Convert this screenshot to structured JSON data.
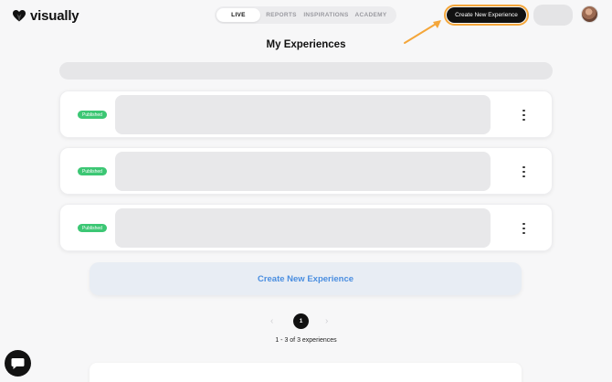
{
  "header": {
    "brand": "visually",
    "tabs": [
      {
        "label": "LIVE",
        "active": true
      },
      {
        "label": "REPORTS",
        "active": false
      },
      {
        "label": "INSPIRATIONS",
        "active": false
      },
      {
        "label": "ACADEMY",
        "active": false
      }
    ],
    "create_button_label": "Create New Experience",
    "highlight_color": "#f4a63a"
  },
  "main": {
    "title": "My Experiences",
    "experiences": [
      {
        "status": "Published"
      },
      {
        "status": "Published"
      },
      {
        "status": "Published"
      }
    ],
    "create_banner_label": "Create New Experience",
    "pagination": {
      "prev": "‹",
      "current_page": "1",
      "next": "›",
      "summary": "1 - 3 of 3 experiences"
    }
  },
  "colors": {
    "accent_blue": "#4a8ee0",
    "status_green": "#3cc774",
    "primary_dark": "#111111"
  }
}
